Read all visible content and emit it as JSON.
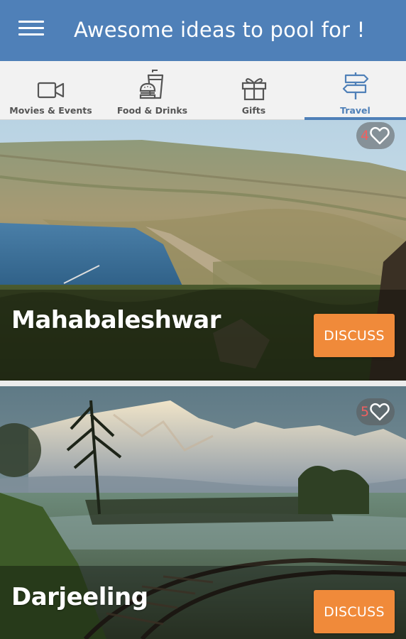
{
  "app": {
    "title": "Awesome ideas to pool for !",
    "menu_icon": "hamburger-menu-icon",
    "accent_color": "#4f80b8"
  },
  "tabs": [
    {
      "label": "Movies & Events",
      "icon": "video-camera-icon",
      "active": false
    },
    {
      "label": "Food & Drinks",
      "icon": "burger-drink-icon",
      "active": false
    },
    {
      "label": "Gifts",
      "icon": "gift-box-icon",
      "active": false
    },
    {
      "label": "Travel",
      "icon": "signpost-icon",
      "active": true
    }
  ],
  "cards": [
    {
      "name": "Mahabaleshwar",
      "likes": "4",
      "button_label": "DISCUSS",
      "like_icon": "heart-outline-icon"
    },
    {
      "name": "Darjeeling",
      "likes": "5",
      "button_label": "DISCUSS",
      "like_icon": "heart-outline-icon"
    }
  ],
  "colors": {
    "button": "#f08a3a",
    "like_count": "#f06060"
  }
}
